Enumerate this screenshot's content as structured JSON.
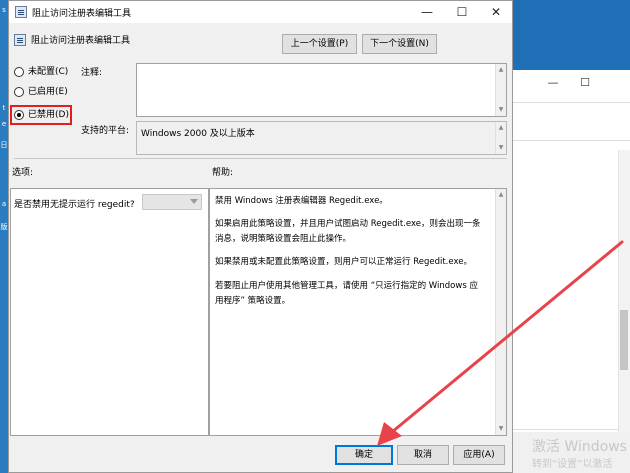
{
  "dialog": {
    "window_title": "阻止访问注册表编辑工具",
    "header_title": "阻止访问注册表编辑工具",
    "prev_button": "上一个设置(P)",
    "next_button": "下一个设置(N)",
    "radios": [
      {
        "label": "未配置(C)",
        "checked": false
      },
      {
        "label": "已启用(E)",
        "checked": false
      },
      {
        "label": "已禁用(D)",
        "checked": true
      }
    ],
    "comment_label": "注释:",
    "comment_value": "",
    "platform_label": "支持的平台:",
    "platform_value": "Windows 2000 及以上版本",
    "options_label": "选项:",
    "help_label": "帮助:",
    "options": {
      "question": "是否禁用无提示运行 regedit?",
      "select_value": ""
    },
    "help_paragraphs": [
      "禁用 Windows 注册表编辑器 Regedit.exe。",
      "如果启用此策略设置，并且用户试图启动 Regedit.exe，则会出现一条消息，说明策略设置会阻止此操作。",
      "如果禁用或未配置此策略设置，则用户可以正常运行 Regedit.exe。",
      "若要阻止用户使用其他管理工具，请使用 “只运行指定的 Windows 应用程序” 策略设置。"
    ],
    "buttons": {
      "ok": "确定",
      "cancel": "取消",
      "apply": "应用(A)"
    }
  },
  "watermark": {
    "line1": "激活 Windows",
    "line2": "转到“设置”以激活"
  },
  "desktop": {
    "left_labels": [
      "s",
      "t",
      "e",
      "日",
      "a",
      "版"
    ]
  },
  "colors": {
    "highlight_box": "#e02020",
    "arrow": "#e8434a",
    "primary_button_border": "#0078d7"
  },
  "icons": [
    "policy-icon",
    "minimize-icon",
    "maximize-icon",
    "close-icon",
    "radio-icon",
    "chevron-down-icon",
    "arrow-annotation"
  ]
}
